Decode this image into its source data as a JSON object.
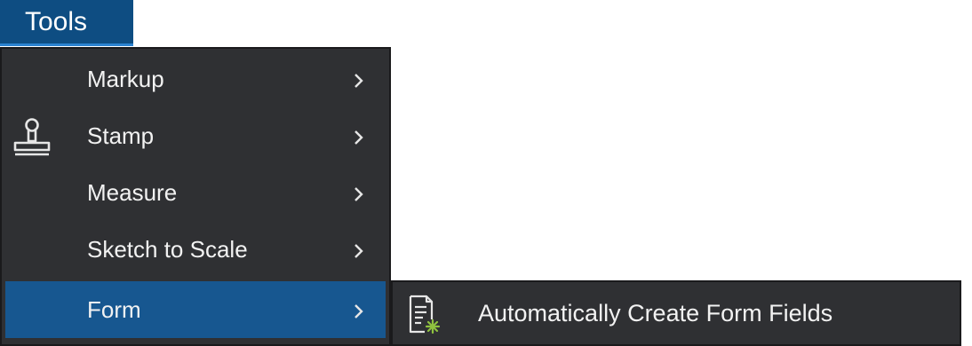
{
  "menubar": {
    "title": "Tools"
  },
  "dropdown": {
    "items": [
      {
        "label": "Markup",
        "icon": "",
        "has_submenu": true
      },
      {
        "label": "Stamp",
        "icon": "stamp-icon",
        "has_submenu": true
      },
      {
        "label": "Measure",
        "icon": "",
        "has_submenu": true
      },
      {
        "label": "Sketch to Scale",
        "icon": "",
        "has_submenu": true
      },
      {
        "label": "Form",
        "icon": "",
        "has_submenu": true,
        "active": true
      }
    ]
  },
  "submenu": {
    "items": [
      {
        "label": "Automatically Create Form Fields",
        "icon": "form-fields-icon"
      }
    ]
  },
  "colors": {
    "menu_bg": "#2f3033",
    "active_bg": "#175790",
    "menubar_bg": "#0e4d82",
    "text": "#f2f2f2",
    "icon_accent": "#8fc23f"
  }
}
